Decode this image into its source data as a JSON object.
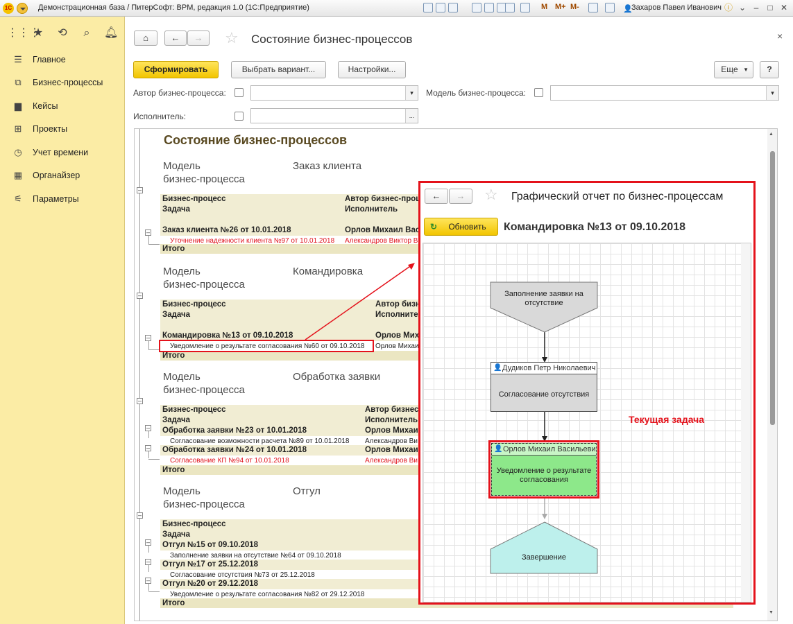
{
  "titlebar": {
    "logo": "1С",
    "title": "Демонстрационная база / ПитерСофт: BPM, редакция 1.0  (1С:Предприятие)",
    "m_buttons": [
      "M",
      "M+",
      "M-"
    ],
    "user": "Захаров Павел Иванович"
  },
  "leftpanel": {
    "items": [
      {
        "label": "Главное",
        "icon": "list-icon"
      },
      {
        "label": "Бизнес-процессы",
        "icon": "flow-icon"
      },
      {
        "label": "Кейсы",
        "icon": "folder-icon"
      },
      {
        "label": "Проекты",
        "icon": "project-icon"
      },
      {
        "label": "Учет времени",
        "icon": "clock-icon"
      },
      {
        "label": "Органайзер",
        "icon": "calendar-icon"
      },
      {
        "label": "Параметры",
        "icon": "settings-icon"
      }
    ]
  },
  "form": {
    "title": "Состояние бизнес-процессов",
    "btn_generate": "Сформировать",
    "btn_variant": "Выбрать вариант...",
    "btn_settings": "Настройки...",
    "btn_more": "Еще",
    "btn_help": "?",
    "filter_author": "Автор бизнес-процесса:",
    "filter_model": "Модель бизнес-процесса:",
    "filter_performer": "Исполнитель:",
    "input_dots": "..."
  },
  "report": {
    "title": "Состояние бизнес-процессов",
    "model_label_1": "Модель",
    "model_label_2": "бизнес-процесса",
    "col_bp": "Бизнес-процесс",
    "col_task": "Задача",
    "col_author": "Автор бизнес-процесса",
    "col_performer": "Исполнитель",
    "total": "Итого",
    "sections": [
      {
        "model": "Заказ клиента",
        "author_short": "Автор бизнес-проце",
        "groups": [
          {
            "name": "Заказ клиента №26 от 10.01.2018",
            "author": "Орлов Михаил Вас",
            "tasks": [
              {
                "name": "Уточнение надежности клиента №97 от 10.01.2018",
                "performer": "Александров Виктор В",
                "red": true
              }
            ]
          }
        ]
      },
      {
        "model": "Командировка",
        "author_short": "Автор бизн",
        "groups": [
          {
            "name": "Командировка №13 от 09.10.2018",
            "author": "Орлов Мих",
            "tasks": [
              {
                "name": "Уведомление о результате согласования №60 от 09.10.2018",
                "performer": "Орлов Михаи",
                "red": false
              }
            ]
          }
        ]
      },
      {
        "model": "Обработка заявки",
        "author_short": "Автор бизнес",
        "groups": [
          {
            "name": "Обработка заявки №23 от 10.01.2018",
            "author": "Орлов Михаи",
            "tasks": [
              {
                "name": "Согласование возможности расчета №89 от 10.01.2018",
                "performer": "Александров Ви",
                "red": false
              }
            ]
          },
          {
            "name": "Обработка заявки №24 от 10.01.2018",
            "author": "Орлов Михаи",
            "tasks": [
              {
                "name": "Согласование КП №94 от 10.01.2018",
                "performer": "Александров Ви",
                "red": true
              }
            ]
          }
        ]
      },
      {
        "model": "Отгул",
        "groups": [
          {
            "name": "Отгул №15 от 09.10.2018",
            "tasks": [
              {
                "name": "Заполнение заявки на отсутствие №64 от 09.10.2018"
              }
            ]
          },
          {
            "name": "Отгул №17 от 25.12.2018",
            "tasks": [
              {
                "name": "Согласование отсутствия №73 от 25.12.2018"
              }
            ]
          },
          {
            "name": "Отгул №20 от 29.12.2018",
            "tasks": [
              {
                "name": "Уведомление о результате согласования №82 от 29.12.2018"
              }
            ]
          }
        ]
      }
    ]
  },
  "overlay": {
    "title": "Графический отчет по бизнес-процессам",
    "btn_refresh": "Обновить",
    "process_title": "Командировка №13 от 09.10.2018",
    "node1": "Заполнение заявки на отсутствие",
    "node2_user": "Дудиков Петр Николаевич",
    "node2_text": "Согласование отсутствия",
    "node3_user": "Орлов Михаил Васильевич",
    "node3_text": "Уведомление о результате согласования",
    "node4": "Завершение",
    "callout": "Текущая задача"
  }
}
